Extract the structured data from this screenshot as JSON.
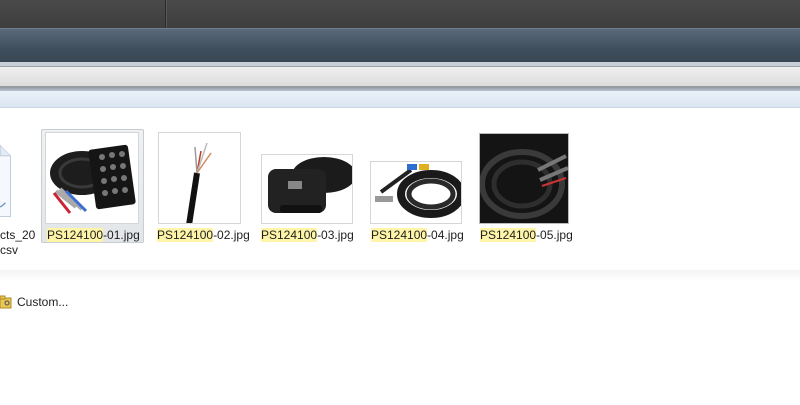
{
  "files": [
    {
      "name_hl": "PS124100",
      "name_rest": "-01.jpg",
      "selected": true,
      "thumb": "multicore-snake-box-icon"
    },
    {
      "name_hl": "PS124100",
      "name_rest": "-02.jpg",
      "selected": false,
      "thumb": "cable-cross-section-icon"
    },
    {
      "name_hl": "PS124100",
      "name_rest": "-03.jpg",
      "selected": false,
      "thumb": "stage-box-bag-icon"
    },
    {
      "name_hl": "PS124100",
      "name_rest": "-04.jpg",
      "selected": false,
      "thumb": "coiled-cable-icon"
    },
    {
      "name_hl": "PS124100",
      "name_rest": "-05.jpg",
      "selected": false,
      "thumb": "cable-closeup-icon"
    }
  ],
  "partial_file": {
    "line1": "cts_20",
    "line2": "csv"
  },
  "custom": {
    "label": "Custom..."
  },
  "colors": {
    "highlight": "#fff5a8",
    "selection": "#e3e6e9",
    "titlebar": "#3f4e5c"
  }
}
